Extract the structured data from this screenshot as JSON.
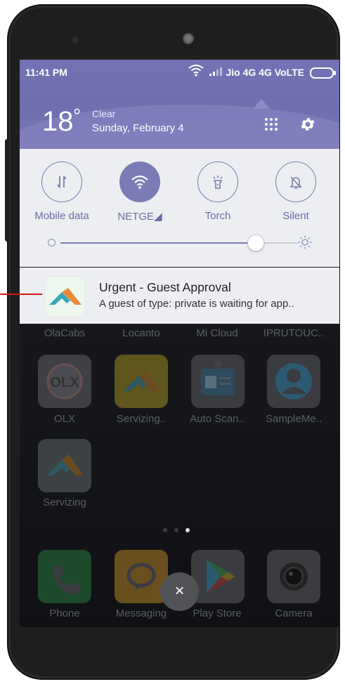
{
  "status_bar": {
    "time": "11:41 PM",
    "carrier": "Jio 4G 4G VoLTE"
  },
  "weather": {
    "temperature": "18",
    "degree_symbol": "°",
    "condition": "Clear",
    "date": "Sunday, February 4"
  },
  "quick_settings": {
    "tiles": [
      {
        "label": "Mobile data",
        "icon": "mobile-data-icon",
        "active": false
      },
      {
        "label": "NETGE◢",
        "icon": "wifi-icon",
        "active": true
      },
      {
        "label": "Torch",
        "icon": "torch-icon",
        "active": false
      },
      {
        "label": "Silent",
        "icon": "silent-bell-icon",
        "active": false
      }
    ],
    "brightness_level": 0.82
  },
  "notification": {
    "title": "Urgent - Guest Approval",
    "body": "A guest of type:  private is waiting for app.."
  },
  "home": {
    "row1_labels": [
      "OlaCabs",
      "Locanto",
      "Mi Cloud",
      "IPRUTOUC.."
    ],
    "row2": [
      {
        "label": "OLX",
        "icon": "olx-icon"
      },
      {
        "label": "Servizing..",
        "icon": "servizing-icon"
      },
      {
        "label": "Auto Scan..",
        "icon": "id-card-icon"
      },
      {
        "label": "SampleMe..",
        "icon": "person-icon"
      }
    ],
    "row3": [
      {
        "label": "Servizing",
        "icon": "servizing-icon"
      }
    ],
    "dock": [
      {
        "label": "Phone",
        "icon": "phone-icon"
      },
      {
        "label": "Messaging",
        "icon": "messaging-icon"
      },
      {
        "label": "Play Store",
        "icon": "play-store-icon"
      },
      {
        "label": "Camera",
        "icon": "camera-icon"
      }
    ],
    "close_symbol": "×"
  },
  "colors": {
    "accent": "#7b7bb6",
    "shade_header": "#7272b4",
    "pointer": "#d41717"
  }
}
